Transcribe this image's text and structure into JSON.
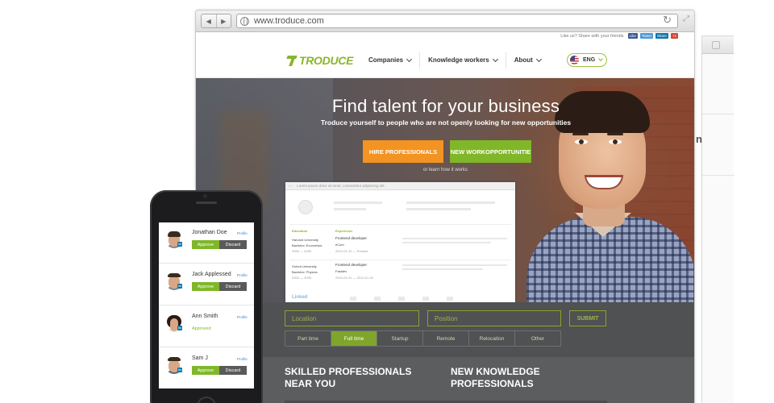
{
  "browser": {
    "url": "www.troduce.com",
    "back": "◀",
    "forward": "▶"
  },
  "share": {
    "text": "Like us? Share with your friends",
    "buttons": [
      "Like",
      "Tweet",
      "Share",
      "+1"
    ]
  },
  "nav": {
    "logo": "TRODUCE",
    "menu": [
      "Companies",
      "Knowledge workers",
      "About"
    ],
    "language": "ENG"
  },
  "hero": {
    "title": "Find talent for your business",
    "subtitle": "Troduce yourself to people who are not openly looking for new opportunities",
    "hire_button": "HIRE PROFESSIONALS",
    "work_button_line1": "NEW WORK",
    "work_button_line2": "OPPORTUNITIE",
    "learn": "or learn how it works"
  },
  "mockup": {
    "bar_text": "Lorem ipsum dolor sit amet, consectetur adipiscing elit.",
    "education_header": "Education",
    "experience_header": "Experience",
    "edu1_school": "Harvard University",
    "edu1_degree": "Bachelor, Economics",
    "edu1_years": "2005 — 2009",
    "job1_title": "Frontend developer",
    "job1_company": "eCom",
    "job1_dates": "2012-01-10 — Present",
    "edu2_school": "Oxford University",
    "edu2_degree": "Bachelor, Physics",
    "edu2_years": "2000 — 2005",
    "job2_title": "Frontend developer",
    "job2_company": "Fastdev",
    "job2_dates": "2010-01-01 — 2012-01-01",
    "linkedin": "Linked"
  },
  "search": {
    "location_placeholder": "Location",
    "position_placeholder": "Position",
    "submit": "SUBMIT",
    "filters": [
      "Part time",
      "Full time",
      "Startup",
      "Remote",
      "Relocation",
      "Other"
    ],
    "active_filter": "Full time"
  },
  "sections": {
    "skilled_line1": "SKILLED PROFESSIONALS",
    "skilled_line2": "NEAR YOU",
    "new_line1": "NEW KNOWLEDGE",
    "new_line2": "PROFESSIONALS"
  },
  "phone": {
    "candidates": [
      {
        "name": "Jonathan Doe",
        "profile": "Profile",
        "approve": "Approve",
        "discard": "Discard"
      },
      {
        "name": "Jack Applessed",
        "profile": "Profile",
        "approve": "Approve",
        "discard": "Discard"
      },
      {
        "name": "Ann Smith",
        "profile": "Profile",
        "status": "Approved"
      },
      {
        "name": "Sam J",
        "profile": "Profile",
        "approve": "Approve",
        "discard": "Discard"
      }
    ]
  },
  "back_window": {
    "letter": "n"
  },
  "colors": {
    "brand_green": "#7fb728",
    "orange": "#f39321",
    "panel_gray": "#4f5152",
    "linkedin_blue": "#0e76a8"
  }
}
